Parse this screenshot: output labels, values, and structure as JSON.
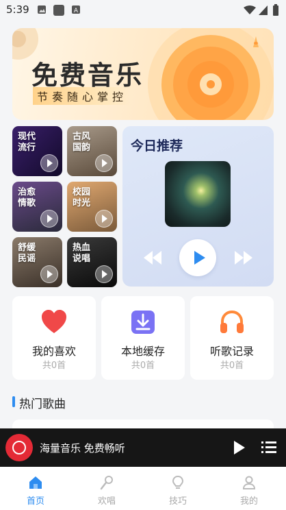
{
  "status": {
    "time": "5:39"
  },
  "banner": {
    "title": "免费音乐",
    "subtitle": "节奏随心掌控"
  },
  "tiles": [
    {
      "label": "现代\n流行",
      "bg": "#2a1a4a"
    },
    {
      "label": "古风\n国韵",
      "bg": "#7a6a5a"
    },
    {
      "label": "治愈\n情歌",
      "bg": "#4a3a6a"
    },
    {
      "label": "校园\n时光",
      "bg": "#c08a5a"
    },
    {
      "label": "舒缓\n民谣",
      "bg": "#6a5a4a"
    },
    {
      "label": "热血\n说唱",
      "bg": "#1a1a1a"
    }
  ],
  "today": {
    "title": "今日推荐"
  },
  "quick": [
    {
      "title": "我的喜欢",
      "count": "共0首",
      "icon": "heart-icon",
      "color": "#f04848"
    },
    {
      "title": "本地缓存",
      "count": "共0首",
      "icon": "download-icon",
      "color": "#6a6af0"
    },
    {
      "title": "听歌记录",
      "count": "共0首",
      "icon": "headphones-icon",
      "color": "#ff7a3a"
    }
  ],
  "hot": {
    "title": "热门歌曲"
  },
  "mini_player": {
    "text": "海量音乐 免费畅听"
  },
  "tabs": [
    {
      "label": "首页",
      "icon": "home-icon",
      "active": true
    },
    {
      "label": "欢唱",
      "icon": "microphone-icon",
      "active": false
    },
    {
      "label": "技巧",
      "icon": "lightbulb-icon",
      "active": false
    },
    {
      "label": "我的",
      "icon": "user-icon",
      "active": false
    }
  ],
  "colors": {
    "accent": "#2d8cf0",
    "background": "#f4f5f7"
  }
}
